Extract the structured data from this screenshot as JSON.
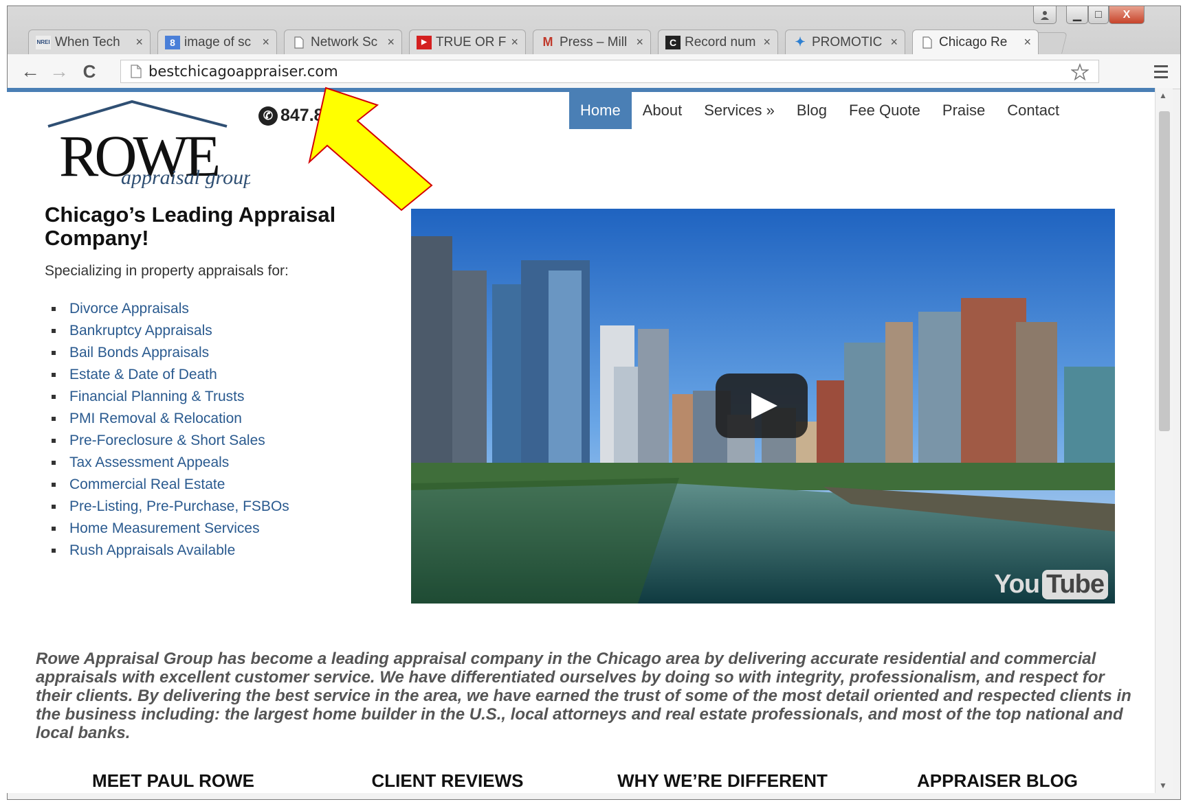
{
  "browser": {
    "tabs": [
      {
        "label": "When Tech",
        "icon": "nrei-favicon-icon",
        "active": false
      },
      {
        "label": "image of sc",
        "icon": "google-favicon-icon",
        "active": false
      },
      {
        "label": "Network Sc",
        "icon": "page-icon",
        "active": false
      },
      {
        "label": "TRUE OR F",
        "icon": "youtube-favicon-icon",
        "active": false
      },
      {
        "label": "Press – Mill",
        "icon": "gmail-favicon-icon",
        "active": false
      },
      {
        "label": "Record num",
        "icon": "chicago-tribune-favicon-icon",
        "active": false
      },
      {
        "label": "PROMOTIC",
        "icon": "dropbox-favicon-icon",
        "active": false
      },
      {
        "label": "Chicago Re",
        "icon": "page-icon",
        "active": true
      }
    ],
    "tab_close_glyph": "×",
    "url": "bestchicagoappraiser.com",
    "nav_glyphs": {
      "back": "←",
      "forward": "→",
      "reload": "C"
    },
    "window_controls": {
      "minimize": "▁",
      "maximize": "□",
      "close": "X"
    }
  },
  "site": {
    "phone": "847.8  .  76",
    "nav": [
      {
        "label": "Home",
        "active": true
      },
      {
        "label": "About",
        "active": false
      },
      {
        "label": "Services »",
        "active": false
      },
      {
        "label": "Blog",
        "active": false
      },
      {
        "label": "Fee Quote",
        "active": false
      },
      {
        "label": "Praise",
        "active": false
      },
      {
        "label": "Contact",
        "active": false
      }
    ],
    "heading": "Chicago’s Leading Appraisal Company!",
    "intro": "Specializing in property appraisals for:",
    "services": [
      "Divorce Appraisals",
      "Bankruptcy Appraisals",
      "Bail Bonds Appraisals",
      "Estate & Date of Death",
      "Financial Planning & Trusts",
      "PMI Removal & Relocation",
      "Pre-Foreclosure & Short Sales",
      "Tax Assessment Appeals",
      "Commercial Real Estate",
      "Pre-Listing, Pre-Purchase, FSBOs",
      "Home Measurement Services",
      "Rush Appraisals Available"
    ],
    "video": {
      "brand_you": "You",
      "brand_tube": "Tube"
    },
    "paragraph": "Rowe Appraisal Group has become a leading appraisal company in the Chicago area by delivering accurate residential and commercial appraisals with excellent customer service. We have differentiated ourselves by doing so with integrity, professionalism, and respect for their clients. By delivering the best service in the area, we have earned the trust of some of the most detail oriented and respected clients in the business including: the largest home builder in the U.S., local attorneys and real estate professionals, and most of the top national and local banks.",
    "bottom_sections": [
      "MEET PAUL ROWE",
      "CLIENT REVIEWS",
      "WHY WE’RE DIFFERENT",
      "APPRAISER BLOG"
    ],
    "logo": {
      "wordmark": "ROWE",
      "tagline": "appraisal group"
    }
  },
  "annotation": {
    "type": "yellow-arrow",
    "points_to": "address-bar"
  },
  "colors": {
    "nav_active": "#4a7fb5",
    "link": "#2a5a8f",
    "arrow_fill": "#ffff00",
    "arrow_stroke": "#d40000"
  }
}
